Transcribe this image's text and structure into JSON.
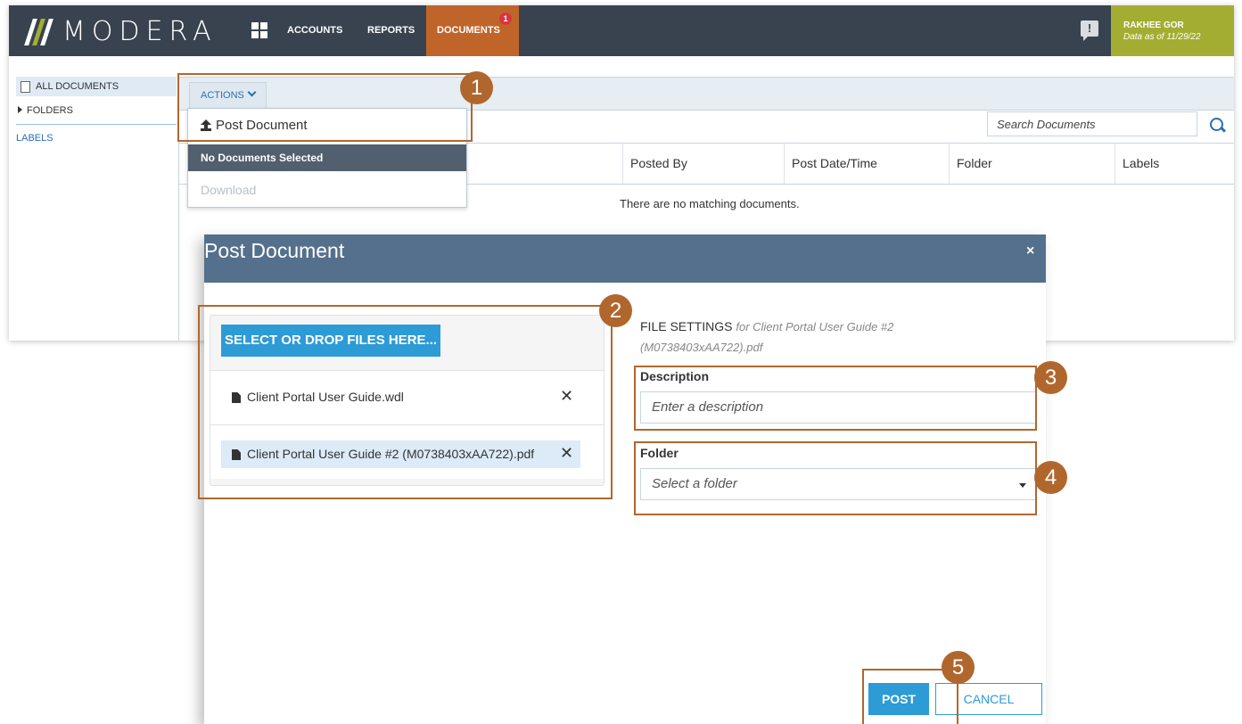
{
  "nav": {
    "logo": "MODERA",
    "items": [
      "ACCOUNTS",
      "REPORTS",
      "DOCUMENTS"
    ],
    "documents_badge": "1",
    "chat_icon": "!",
    "user_name": "RAKHEE GOR",
    "data_as_of": "Data as of 11/29/22",
    "accent_color": "#c0652a",
    "user_color": "#a3ad32"
  },
  "sidebar": {
    "all_documents": "ALL DOCUMENTS",
    "folders": "FOLDERS",
    "labels": "LABELS"
  },
  "toolbar": {
    "actions_label": "ACTIONS",
    "search_placeholder": "Search Documents"
  },
  "table": {
    "columns": [
      "Posted By",
      "Post Date/Time",
      "Folder",
      "Labels"
    ],
    "empty_message": "There are no matching documents."
  },
  "actions_menu": {
    "post_document": "Post Document",
    "selection_header": "No Documents Selected",
    "download": "Download"
  },
  "modal": {
    "title": "Post Document",
    "close": "×",
    "select_button": "SELECT OR DROP FILES HERE...",
    "files": [
      {
        "name": "Client Portal User Guide.wdl"
      },
      {
        "name": "Client Portal User Guide #2 (M0738403xAA722).pdf"
      }
    ],
    "remove_icon": "✕",
    "settings_label": "FILE SETTINGS",
    "settings_file": "for Client Portal User Guide #2 (M0738403xAA722).pdf",
    "description_label": "Description",
    "description_placeholder": "Enter a description",
    "folder_label": "Folder",
    "folder_placeholder": "Select a folder",
    "post_button": "POST",
    "cancel_button": "CANCEL"
  },
  "callouts": [
    "1",
    "2",
    "3",
    "4",
    "5"
  ],
  "callout_color": "#b0672e"
}
